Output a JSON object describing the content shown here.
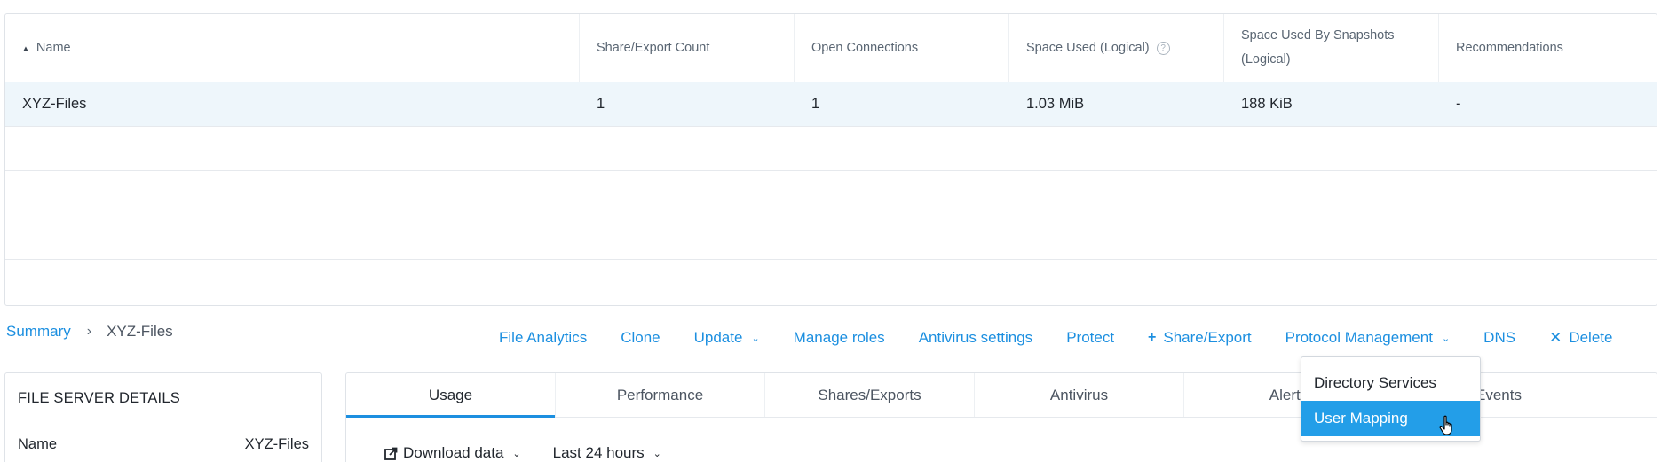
{
  "table": {
    "columns": [
      {
        "label": "Name",
        "sorted": "ascending"
      },
      {
        "label": "Share/Export Count"
      },
      {
        "label": "Open Connections"
      },
      {
        "label": "Space Used (Logical)",
        "help": true
      },
      {
        "label": "Space Used By Snapshots\n(Logical)"
      },
      {
        "label": "Recommendations"
      }
    ],
    "rows": [
      [
        "XYZ-Files",
        "1",
        "1",
        "1.03 MiB",
        "188 KiB",
        "-"
      ]
    ]
  },
  "breadcrumb": {
    "root": "Summary",
    "separator": "›",
    "current": "XYZ-Files"
  },
  "actions": {
    "file_analytics": "File Analytics",
    "clone": "Clone",
    "update": "Update",
    "manage_roles": "Manage roles",
    "antivirus_settings": "Antivirus settings",
    "protect": "Protect",
    "share_export": "Share/Export",
    "protocol_management": "Protocol Management",
    "dns": "DNS",
    "delete": "Delete"
  },
  "protocol_dropdown": {
    "items": [
      "Directory Services",
      "User Mapping"
    ],
    "highlighted": "User Mapping"
  },
  "details_panel": {
    "title": "FILE SERVER DETAILS",
    "name_label": "Name",
    "name_value": "XYZ-Files"
  },
  "tabs": {
    "items": [
      "Usage",
      "Performance",
      "Shares/Exports",
      "Antivirus",
      "Alerts",
      "Events"
    ],
    "active": "Usage"
  },
  "toolbar": {
    "download": "Download data",
    "range": "Last 24 hours"
  },
  "colors": {
    "accent": "#1c8fe0",
    "selected_row": "#eef6fb",
    "dropdown_highlight": "#239ee8"
  }
}
